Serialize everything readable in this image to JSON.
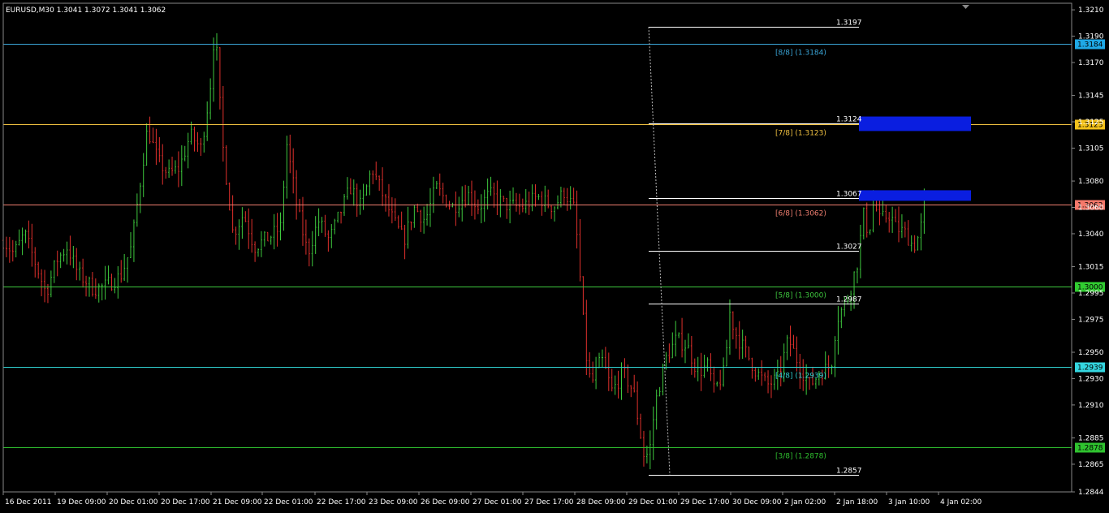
{
  "chart_data": {
    "type": "candlestick",
    "header": "EURUSD,M30  1.3041 1.3072 1.3041 1.3062",
    "ylim": [
      1.2844,
      1.3215
    ],
    "y_ticks": [
      "1.3210",
      "1.3190",
      "1.3170",
      "1.3145",
      "1.3125",
      "1.3105",
      "1.3080",
      "1.3060",
      "1.3040",
      "1.3015",
      "1.2995",
      "1.2975",
      "1.2950",
      "1.2930",
      "1.2910",
      "1.2885",
      "1.2865",
      "1.2844"
    ],
    "time_labels": [
      "16 Dec 2011",
      "19 Dec 09:00",
      "20 Dec 01:00",
      "20 Dec 17:00",
      "21 Dec 09:00",
      "22 Dec 01:00",
      "22 Dec 17:00",
      "23 Dec 09:00",
      "26 Dec 09:00",
      "27 Dec 01:00",
      "27 Dec 17:00",
      "28 Dec 09:00",
      "29 Dec 01:00",
      "29 Dec 17:00",
      "30 Dec 09:00",
      "2 Jan 02:00",
      "2 Jan 18:00",
      "3 Jan 10:00",
      "4 Jan 02:00"
    ],
    "murrey_levels": [
      {
        "label": "[8/8]  (1.3184)",
        "price": 1.3184,
        "tag": "1.3184",
        "color": "#3aa6d8",
        "tag_bg": "#1fa9e6"
      },
      {
        "label": "[7/8]  (1.3123)",
        "price": 1.3123,
        "tag": "1.3123",
        "color": "#f0c040",
        "tag_bg": "#f3c21b"
      },
      {
        "label": "[6/8]  (1.3062)",
        "price": 1.3062,
        "tag": "1.3062",
        "color": "#f07f70",
        "tag_bg": "#f5786a"
      },
      {
        "label": "[5/8]  (1.3000)",
        "price": 1.3,
        "tag": "1.3000",
        "color": "#3ec73e",
        "tag_bg": "#31cc31"
      },
      {
        "label": "[4/8]  (1.2939)",
        "price": 1.2939,
        "tag": "1.2939",
        "color": "#30d0d0",
        "tag_bg": "#34d6e0"
      },
      {
        "label": "[3/8]  (1.2878)",
        "price": 1.2878,
        "tag": "1.2878",
        "color": "#2fc02f",
        "tag_bg": "#2fc22f"
      }
    ],
    "fib_levels": [
      {
        "label": "1.3197",
        "price": 1.3197
      },
      {
        "label": "1.3124",
        "price": 1.3124
      },
      {
        "label": "1.3067",
        "price": 1.3067
      },
      {
        "label": "1.3027",
        "price": 1.3027
      },
      {
        "label": "1.2987",
        "price": 1.2987
      },
      {
        "label": "1.2857",
        "price": 1.2857
      }
    ],
    "zones": [
      {
        "top": 1.3129,
        "bottom": 1.3118,
        "color": "#0a1ee0"
      },
      {
        "top": 1.3073,
        "bottom": 1.3065,
        "color": "#0a1ee0"
      }
    ],
    "path": [
      [
        0,
        1.3035
      ],
      [
        0.01,
        1.3025
      ],
      [
        0.02,
        1.304
      ],
      [
        0.03,
        1.3018
      ],
      [
        0.04,
        1.2995
      ],
      [
        0.05,
        1.302
      ],
      [
        0.06,
        1.303
      ],
      [
        0.07,
        1.301
      ],
      [
        0.085,
        1.2998
      ],
      [
        0.095,
        1.3
      ],
      [
        0.11,
        1.3008
      ],
      [
        0.12,
        1.303
      ],
      [
        0.125,
        1.306
      ],
      [
        0.13,
        1.309
      ],
      [
        0.135,
        1.312
      ],
      [
        0.145,
        1.3095
      ],
      [
        0.155,
        1.3085
      ],
      [
        0.165,
        1.309
      ],
      [
        0.175,
        1.3115
      ],
      [
        0.185,
        1.3105
      ],
      [
        0.19,
        1.313
      ],
      [
        0.195,
        1.316
      ],
      [
        0.198,
        1.32
      ],
      [
        0.205,
        1.311
      ],
      [
        0.215,
        1.304
      ],
      [
        0.225,
        1.3055
      ],
      [
        0.235,
        1.303
      ],
      [
        0.25,
        1.3038
      ],
      [
        0.26,
        1.3045
      ],
      [
        0.265,
        1.311
      ],
      [
        0.275,
        1.306
      ],
      [
        0.285,
        1.3025
      ],
      [
        0.295,
        1.305
      ],
      [
        0.305,
        1.3035
      ],
      [
        0.315,
        1.3055
      ],
      [
        0.325,
        1.3075
      ],
      [
        0.335,
        1.306
      ],
      [
        0.345,
        1.309
      ],
      [
        0.355,
        1.307
      ],
      [
        0.365,
        1.305
      ],
      [
        0.375,
        1.3035
      ],
      [
        0.385,
        1.306
      ],
      [
        0.395,
        1.305
      ],
      [
        0.405,
        1.3075
      ],
      [
        0.42,
        1.306
      ],
      [
        0.435,
        1.307
      ],
      [
        0.445,
        1.306
      ],
      [
        0.455,
        1.307
      ],
      [
        0.47,
        1.3062
      ],
      [
        0.485,
        1.306
      ],
      [
        0.5,
        1.3068
      ],
      [
        0.515,
        1.306
      ],
      [
        0.525,
        1.3072
      ],
      [
        0.535,
        1.3058
      ],
      [
        0.54,
        1.3005
      ],
      [
        0.545,
        1.295
      ],
      [
        0.55,
        1.2925
      ],
      [
        0.56,
        1.2945
      ],
      [
        0.57,
        1.292
      ],
      [
        0.58,
        1.2935
      ],
      [
        0.59,
        1.292
      ],
      [
        0.6,
        1.287
      ],
      [
        0.605,
        1.2875
      ],
      [
        0.61,
        1.291
      ],
      [
        0.62,
        1.2945
      ],
      [
        0.63,
        1.296
      ],
      [
        0.64,
        1.2955
      ],
      [
        0.65,
        1.2935
      ],
      [
        0.66,
        1.294
      ],
      [
        0.665,
        1.292
      ],
      [
        0.675,
        1.2935
      ],
      [
        0.68,
        1.298
      ],
      [
        0.685,
        1.2965
      ],
      [
        0.695,
        1.295
      ],
      [
        0.705,
        1.2935
      ],
      [
        0.715,
        1.2925
      ],
      [
        0.725,
        1.293
      ],
      [
        0.735,
        1.296
      ],
      [
        0.745,
        1.294
      ],
      [
        0.755,
        1.2925
      ],
      [
        0.765,
        1.2935
      ],
      [
        0.775,
        1.294
      ],
      [
        0.78,
        1.2975
      ],
      [
        0.79,
        1.299
      ],
      [
        0.8,
        1.302
      ],
      [
        0.805,
        1.3055
      ],
      [
        0.81,
        1.304
      ],
      [
        0.815,
        1.3065
      ],
      [
        0.82,
        1.305
      ],
      [
        0.83,
        1.3055
      ],
      [
        0.835,
        1.3045
      ],
      [
        0.845,
        1.304
      ],
      [
        0.852,
        1.303
      ],
      [
        0.858,
        1.304
      ],
      [
        0.862,
        1.3062
      ]
    ]
  }
}
